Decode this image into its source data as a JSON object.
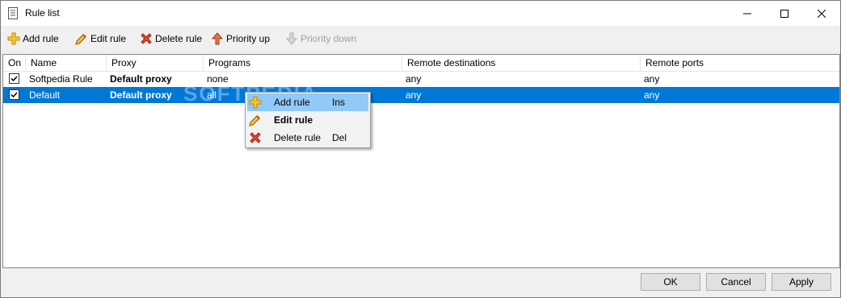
{
  "window": {
    "title": "Rule list"
  },
  "toolbar": {
    "add_rule": "Add rule",
    "edit_rule": "Edit rule",
    "delete_rule": "Delete rule",
    "priority_up": "Priority up",
    "priority_down": "Priority down"
  },
  "columns": [
    "On",
    "Name",
    "Proxy",
    "Programs",
    "Remote destinations",
    "Remote ports"
  ],
  "rows": [
    {
      "on": true,
      "name": "Softpedia Rule",
      "proxy": "Default proxy",
      "programs": "none",
      "destinations": "any",
      "ports": "any"
    },
    {
      "on": true,
      "name": "Default",
      "proxy": "Default proxy",
      "programs": "all",
      "destinations": "any",
      "ports": "any",
      "selected": true
    }
  ],
  "context_menu": {
    "items": [
      {
        "label": "Add rule",
        "shortcut": "Ins",
        "icon": "add-icon"
      },
      {
        "label": "Edit rule",
        "shortcut": "",
        "icon": "pencil-icon"
      },
      {
        "label": "Delete rule",
        "shortcut": "Del",
        "icon": "delete-icon"
      }
    ]
  },
  "watermark": "SOFTPEDIA",
  "buttons": {
    "ok": "OK",
    "cancel": "Cancel",
    "apply": "Apply"
  },
  "colors": {
    "selection": "#0078d7",
    "menu_highlight": "#91c9f7"
  }
}
